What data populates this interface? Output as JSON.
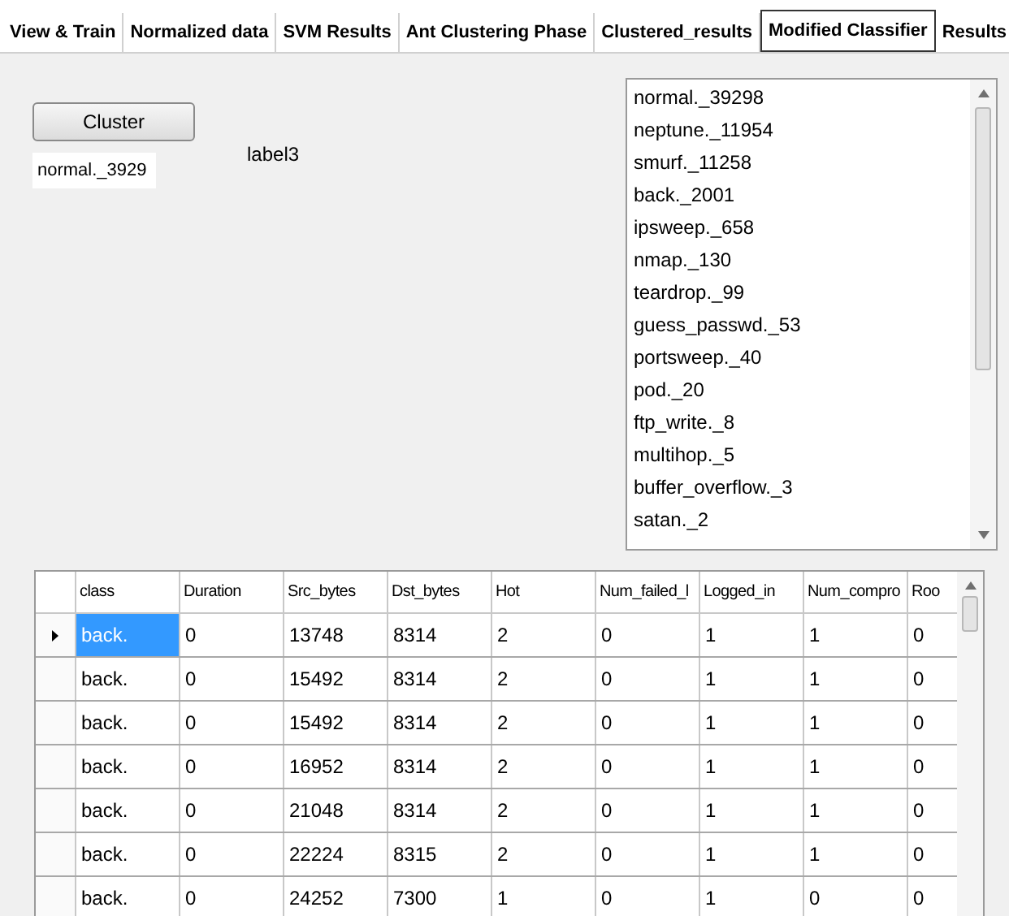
{
  "tabs": [
    {
      "label": "View & Train",
      "selected": false
    },
    {
      "label": "Normalized data",
      "selected": false
    },
    {
      "label": "SVM Results",
      "selected": false
    },
    {
      "label": "Ant Clustering Phase",
      "selected": false
    },
    {
      "label": "Clustered_results",
      "selected": false
    },
    {
      "label": "Modified Classifier",
      "selected": true
    },
    {
      "label": "Results",
      "selected": false
    }
  ],
  "cluster_button": {
    "label": "Cluster"
  },
  "result_field": {
    "value": "normal._3929"
  },
  "label": "label3",
  "cluster_list": [
    "normal._39298",
    "neptune._11954",
    "smurf._11258",
    "back._2001",
    "ipsweep._658",
    "nmap._130",
    "teardrop._99",
    "guess_passwd._53",
    "portsweep._40",
    "pod._20",
    "ftp_write._8",
    "multihop._5",
    "buffer_overflow._3",
    "satan._2"
  ],
  "table": {
    "columns": [
      "class",
      "Duration",
      "Src_bytes",
      "Dst_bytes",
      "Hot",
      "Num_failed_l",
      "Logged_in",
      "Num_compro",
      "Roo"
    ],
    "rows": [
      {
        "selected": true,
        "cells": [
          "back.",
          "0",
          "13748",
          "8314",
          "2",
          "0",
          "1",
          "1",
          "0"
        ]
      },
      {
        "selected": false,
        "cells": [
          "back.",
          "0",
          "15492",
          "8314",
          "2",
          "0",
          "1",
          "1",
          "0"
        ]
      },
      {
        "selected": false,
        "cells": [
          "back.",
          "0",
          "15492",
          "8314",
          "2",
          "0",
          "1",
          "1",
          "0"
        ]
      },
      {
        "selected": false,
        "cells": [
          "back.",
          "0",
          "16952",
          "8314",
          "2",
          "0",
          "1",
          "1",
          "0"
        ]
      },
      {
        "selected": false,
        "cells": [
          "back.",
          "0",
          "21048",
          "8314",
          "2",
          "0",
          "1",
          "1",
          "0"
        ]
      },
      {
        "selected": false,
        "cells": [
          "back.",
          "0",
          "22224",
          "8315",
          "2",
          "0",
          "1",
          "1",
          "0"
        ]
      },
      {
        "selected": false,
        "cells": [
          "back.",
          "0",
          "24252",
          "7300",
          "1",
          "0",
          "1",
          "0",
          "0"
        ]
      }
    ]
  }
}
